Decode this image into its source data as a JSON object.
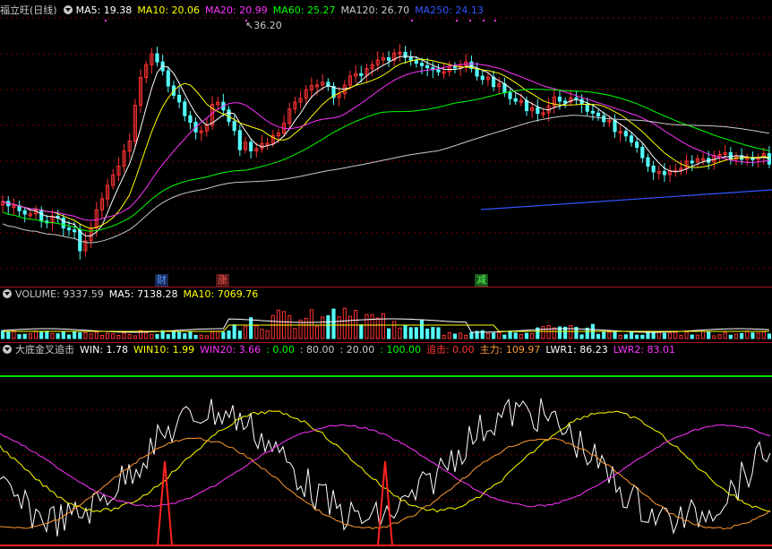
{
  "main_header": {
    "stock": "福立旺(日线)",
    "items": [
      {
        "label": "MA5: 19.38",
        "color": "#ffffff"
      },
      {
        "label": "MA10: 20.06",
        "color": "#ffff00"
      },
      {
        "label": "MA20: 20.99",
        "color": "#ff33ff"
      },
      {
        "label": "MA60: 25.27",
        "color": "#00ff00"
      },
      {
        "label": "MA120: 26.70",
        "color": "#c8c8c8"
      },
      {
        "label": "MA250: 24.13",
        "color": "#3355ff"
      }
    ]
  },
  "price_high_label": "36.20",
  "signals": [
    {
      "label": "财",
      "color": "#5599ff",
      "bg": "#1a2a55"
    },
    {
      "label": "涨",
      "color": "#ff5555",
      "bg": "#551a1a"
    },
    {
      "label": "减",
      "color": "#55ff55",
      "bg": "#1a551a"
    }
  ],
  "volume_header": {
    "title": "VOLUME: 9337.59",
    "items": [
      {
        "label": "MA5: 7138.28",
        "color": "#ffffff"
      },
      {
        "label": "MA10: 7069.76",
        "color": "#ffff00"
      }
    ]
  },
  "indicator_header": {
    "title": "大底金叉追击",
    "items": [
      {
        "label": "WIN: 1.78",
        "color": "#ffffff"
      },
      {
        "label": "WIN10: 1.99",
        "color": "#ffff00"
      },
      {
        "label": "WIN20: 3.66",
        "color": "#ff33ff"
      },
      {
        "label": ": 0.00",
        "color": "#00ff00"
      },
      {
        "label": ": 80.00",
        "color": "#c8c8c8"
      },
      {
        "label": ": 20.00",
        "color": "#c8c8c8"
      },
      {
        "label": ": 100.00",
        "color": "#00ff00"
      },
      {
        "label": "追击: 0.00",
        "color": "#ff3333"
      },
      {
        "label": "主力: 109.97",
        "color": "#ff9933"
      },
      {
        "label": "LWR1: 86.23",
        "color": "#ffffff"
      },
      {
        "label": "LWR2: 83.01",
        "color": "#ff33ff"
      }
    ]
  },
  "colors": {
    "up": "#ff3333",
    "down": "#54fcfc",
    "grid": "#7a0000"
  }
}
